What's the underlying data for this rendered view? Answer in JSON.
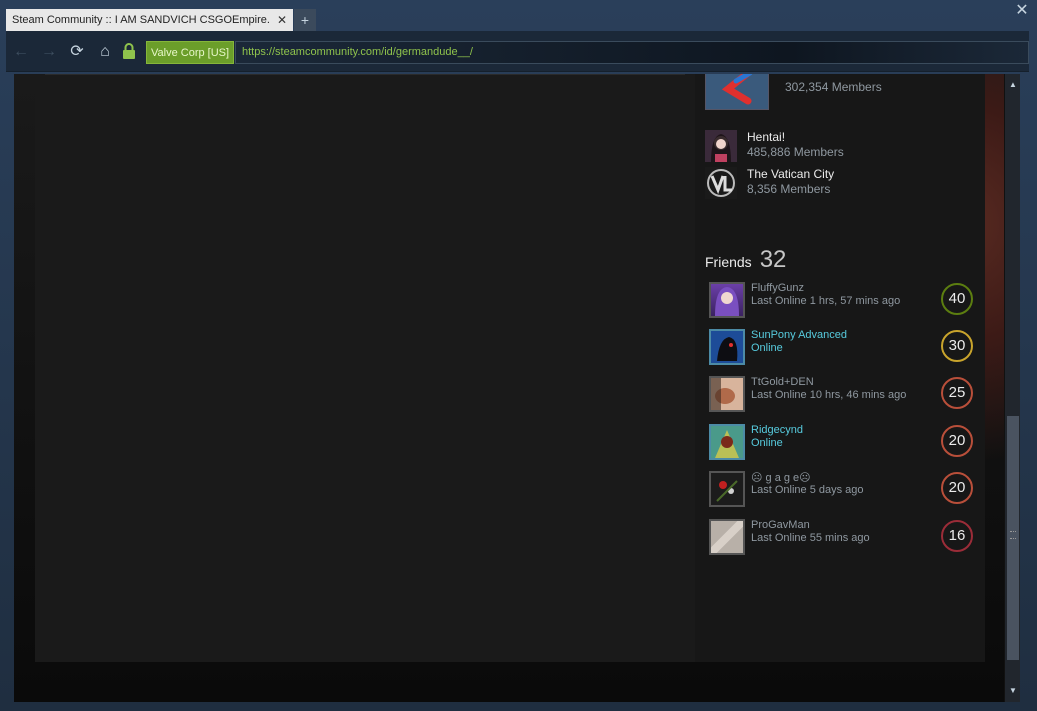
{
  "window": {
    "close_glyph": "✕"
  },
  "tab": {
    "title": "Steam Community :: I AM SANDVICH CSGOEmpire.com",
    "close_glyph": "✕",
    "new_tab_glyph": "+"
  },
  "nav": {
    "back_glyph": "←",
    "forward_glyph": "→",
    "reload_glyph": "⟳",
    "home_glyph": "⌂",
    "lock_glyph": "🔒",
    "cert_label": "Valve Corp [US]",
    "url": "https://steamcommunity.com/id/germandude__/"
  },
  "groups": [
    {
      "name": "",
      "members": "302,354 Members",
      "icon": "red-logo-icon"
    },
    {
      "name": "Hentai!",
      "members": "485,886 Members",
      "icon": "anime-avatar-icon"
    },
    {
      "name": "The Vatican City",
      "members": "8,356 Members",
      "icon": "vc-logo-icon"
    }
  ],
  "friends_section": {
    "label": "Friends",
    "count": "32"
  },
  "friends": [
    {
      "name": "FluffyGunz",
      "status": "Last Online 1 hrs, 57 mins ago",
      "level": "40",
      "online": false,
      "level_color": "#5c7e10"
    },
    {
      "name": "SunPony Advanced",
      "status": "Online",
      "level": "30",
      "online": true,
      "level_color": "#c9a42c"
    },
    {
      "name": "TtGold+DEN",
      "status": "Last Online 10 hrs, 46 mins ago",
      "level": "25",
      "online": false,
      "level_color": "#b94f3a"
    },
    {
      "name": "Ridgecynd",
      "status": "Online",
      "level": "20",
      "online": true,
      "level_color": "#b94f3a"
    },
    {
      "name": "☹ g a g e☹",
      "status": "Last Online 5 days ago",
      "level": "20",
      "online": false,
      "level_color": "#b94f3a"
    },
    {
      "name": "ProGavMan",
      "status": "Last Online 55 mins ago",
      "level": "16",
      "online": false,
      "level_color": "#9b2c38"
    }
  ],
  "scrollbar": {
    "up_glyph": "▲",
    "down_glyph": "▼"
  }
}
